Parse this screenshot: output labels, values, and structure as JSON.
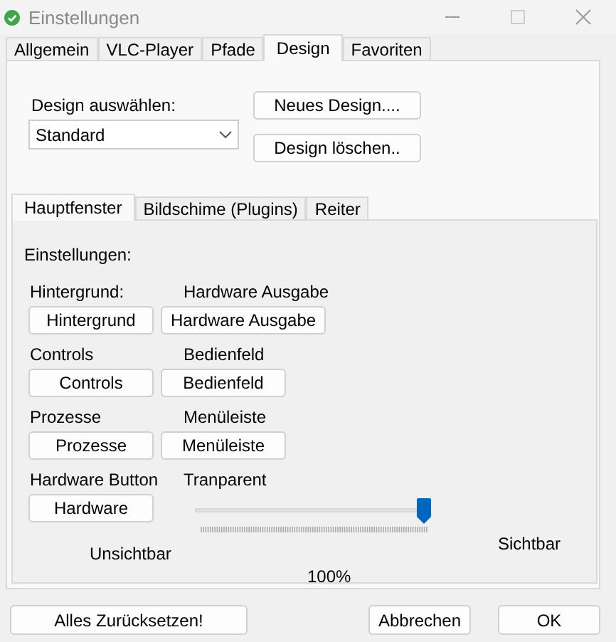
{
  "window": {
    "title": "Einstellungen"
  },
  "tabs": [
    {
      "label": "Allgemein",
      "selected": false
    },
    {
      "label": "VLC-Player",
      "selected": false
    },
    {
      "label": "Pfade",
      "selected": false
    },
    {
      "label": "Design",
      "selected": true
    },
    {
      "label": "Favoriten",
      "selected": false
    }
  ],
  "design": {
    "label": "Design auswählen:",
    "select_value": "Standard",
    "buttons": [
      "Neues Design....",
      "Design löschen.."
    ]
  },
  "subtabs": [
    {
      "label": "Hauptfenster",
      "selected": true
    },
    {
      "label": "Bildschime (Plugins)",
      "selected": false
    },
    {
      "label": "Reiter",
      "selected": false
    }
  ],
  "settings": {
    "heading": "Einstellungen:",
    "left": [
      {
        "label": "Hintergrund:",
        "button": "Hintergrund"
      },
      {
        "label": "Controls",
        "button": "Controls"
      },
      {
        "label": "Prozesse",
        "button": "Prozesse"
      },
      {
        "label": "Hardware Button",
        "button": "Hardware"
      }
    ],
    "right": [
      {
        "label": "Hardware Ausgabe",
        "button": "Hardware Ausgabe"
      },
      {
        "label": "Bedienfeld",
        "button": "Bedienfeld"
      },
      {
        "label": "Menüleiste",
        "button": "Menüleiste"
      }
    ]
  },
  "transparency": {
    "label": "Tranparent",
    "level": 1,
    "min_label": "Unsichtbar",
    "max_label": "Sichtbar",
    "reading": "100%"
  },
  "footer_buttons": [
    "Alles Zurücksetzen!",
    "Abbrechen",
    "OK"
  ]
}
